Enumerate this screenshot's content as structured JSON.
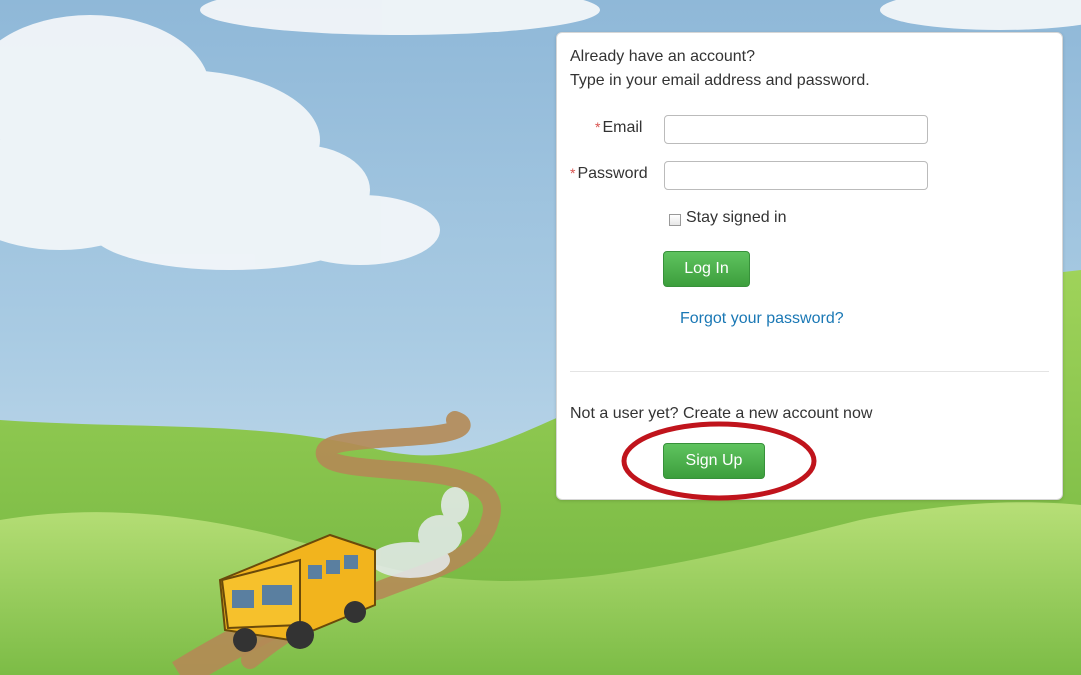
{
  "login": {
    "intro_line1": "Already have an account?",
    "intro_line2": "Type in your email address and password.",
    "email_label": "Email",
    "password_label": "Password",
    "required_mark": "*",
    "email_value": "",
    "password_value": "",
    "stay_signed_in_label": "Stay signed in",
    "stay_signed_in_checked": false,
    "login_button": "Log In",
    "forgot_link": "Forgot your password?"
  },
  "signup": {
    "prompt": "Not a user yet? Create a new account now",
    "button": "Sign Up"
  },
  "colors": {
    "accent_green": "#4cae4c",
    "link_blue": "#1a78b5",
    "required_red": "#d9534f",
    "highlight_red": "#c0141c"
  }
}
